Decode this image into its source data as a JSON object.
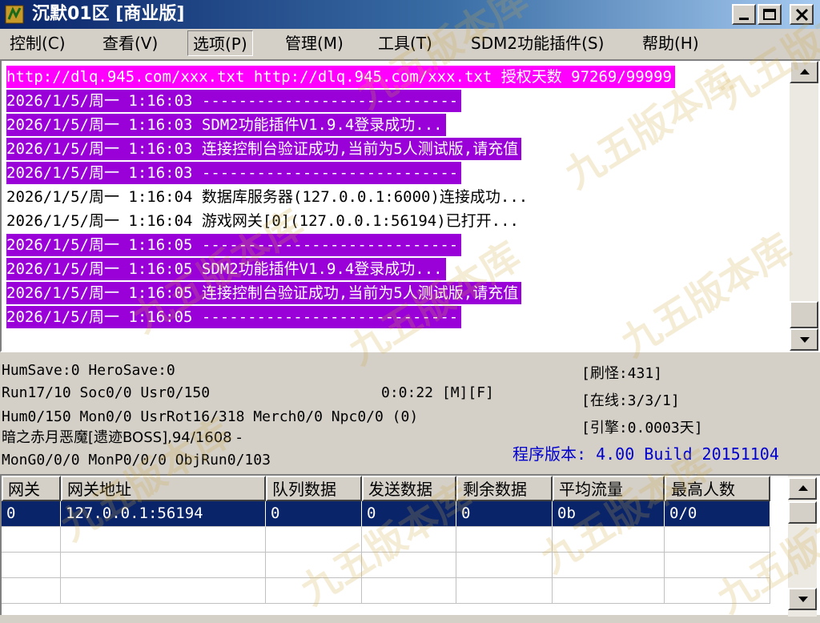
{
  "window": {
    "title": "沉默01区 [商业版]"
  },
  "menu": [
    {
      "label": "控制(C)"
    },
    {
      "label": "查看(V)"
    },
    {
      "label": "选项(P)"
    },
    {
      "label": "管理(M)"
    },
    {
      "label": "工具(T)"
    },
    {
      "label": "SDM2功能插件(S)"
    },
    {
      "label": "帮助(H)"
    }
  ],
  "log": [
    {
      "text": "http://dlq.945.com/xxx.txt http://dlq.945.com/xxx.txt 授权天数 97269/99999",
      "style": "magenta"
    },
    {
      "text": "2026/1/5/周一 1:16:03 ----------------------------",
      "style": "purple"
    },
    {
      "text": "2026/1/5/周一 1:16:03 SDM2功能插件V1.9.4登录成功...",
      "style": "purple"
    },
    {
      "text": "2026/1/5/周一 1:16:03 连接控制台验证成功,当前为5人测试版,请充值",
      "style": "purple"
    },
    {
      "text": "2026/1/5/周一 1:16:03 ----------------------------",
      "style": "purple"
    },
    {
      "text": "2026/1/5/周一 1:16:04 数据库服务器(127.0.0.1:6000)连接成功...",
      "style": "plain"
    },
    {
      "text": "2026/1/5/周一 1:16:04 游戏网关[0](127.0.0.1:56194)已打开...",
      "style": "plain"
    },
    {
      "text": "2026/1/5/周一 1:16:05 ----------------------------",
      "style": "purple"
    },
    {
      "text": "2026/1/5/周一 1:16:05 SDM2功能插件V1.9.4登录成功...",
      "style": "purple"
    },
    {
      "text": "2026/1/5/周一 1:16:05 连接控制台验证成功,当前为5人测试版,请充值",
      "style": "purple"
    },
    {
      "text": "2026/1/5/周一 1:16:05 ----------------------------",
      "style": "purple"
    }
  ],
  "status": {
    "line1": "HumSave:0 HeroSave:0",
    "line2": "Run17/10 Soc0/0 Usr0/150",
    "timer": "0:0:22 [M][F]",
    "line3": "Hum0/150 Mon0/0 UsrRot16/318 Merch0/0 Npc0/0 (0)",
    "line4": "暗之赤月恶魔[遗迹BOSS],94/1608 -",
    "line5": "MonG0/0/0 MonP0/0/0 ObjRun0/103",
    "refresh": "[刷怪:431]",
    "online": "[在线:3/3/1]",
    "engine": "[引擎:0.0003天]",
    "version": "程序版本: 4.00 Build 20151104"
  },
  "grid": {
    "headers": [
      "网关",
      "网关地址",
      "队列数据",
      "发送数据",
      "剩余数据",
      "平均流量",
      "最高人数"
    ],
    "rows": [
      [
        "0",
        "127.0.0.1:56194",
        "0",
        "0",
        "0",
        "0b",
        "0/0"
      ]
    ]
  },
  "watermark": "九五版本库",
  "colors": {
    "log_purple": "#9a00d8",
    "log_magenta": "#ff00ff",
    "selection": "#0a246a",
    "version_blue": "#0000cc"
  }
}
